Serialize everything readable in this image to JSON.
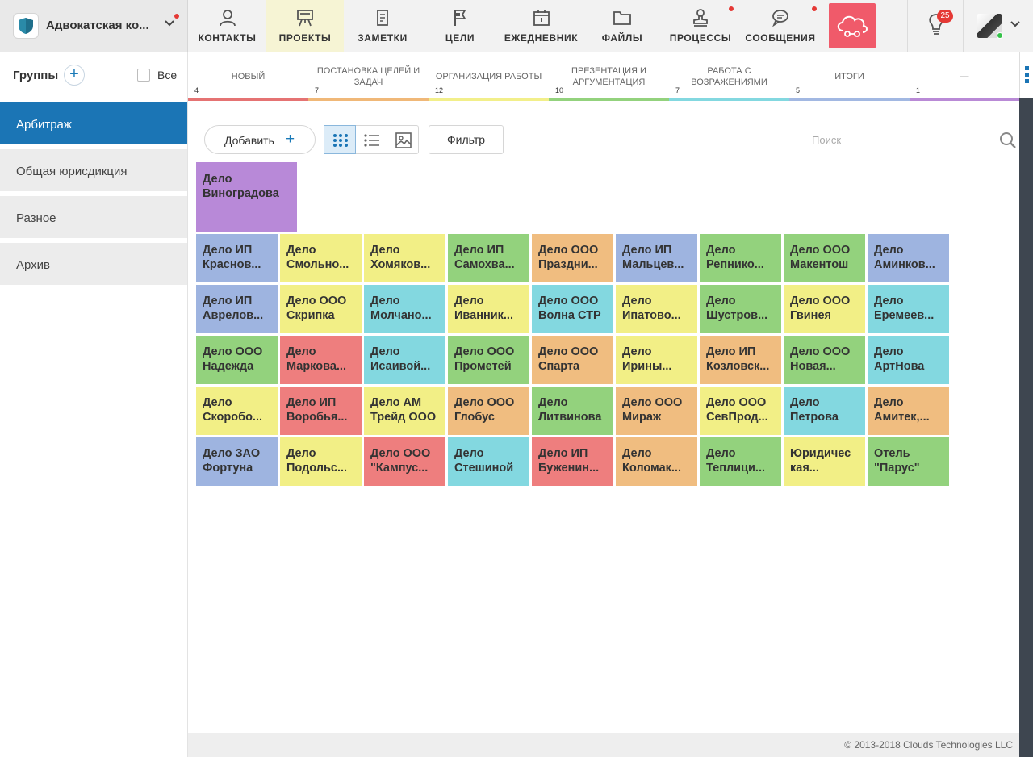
{
  "brand": {
    "name": "Адвокатская ко..."
  },
  "nav": [
    {
      "label": "КОНТАКТЫ",
      "icon": "user-icon"
    },
    {
      "label": "ПРОЕКТЫ",
      "icon": "easel-icon"
    },
    {
      "label": "ЗАМЕТКИ",
      "icon": "notes-icon"
    },
    {
      "label": "ЦЕЛИ",
      "icon": "flag-icon"
    },
    {
      "label": "ЕЖЕДНЕВНИК",
      "icon": "calendar-icon"
    },
    {
      "label": "ФАЙЛЫ",
      "icon": "folder-icon"
    },
    {
      "label": "ПРОЦЕССЫ",
      "icon": "stamp-icon"
    },
    {
      "label": "СООБЩЕНИЯ",
      "icon": "chat-icon"
    }
  ],
  "notifications": {
    "count": "25"
  },
  "sidebar": {
    "title": "Группы",
    "all_label": "Все",
    "groups": [
      "Арбитраж",
      "Общая юрисдикция",
      "Разное",
      "Архив"
    ]
  },
  "stages": [
    {
      "name": "НОВЫЙ",
      "count": "4",
      "color": "#e57373"
    },
    {
      "name": "ПОСТАНОВКА ЦЕЛЕЙ И ЗАДАЧ",
      "count": "7",
      "color": "#f0b878"
    },
    {
      "name": "ОРГАНИЗАЦИЯ РАБОТЫ",
      "count": "12",
      "color": "#f2ef8a"
    },
    {
      "name": "ПРЕЗЕНТАЦИЯ И АРГУМЕНТАЦИЯ",
      "count": "10",
      "color": "#93d27d"
    },
    {
      "name": "РАБОТА С ВОЗРАЖЕНИЯМИ",
      "count": "7",
      "color": "#83d8e0"
    },
    {
      "name": "ИТОГИ",
      "count": "5",
      "color": "#a2b8e2"
    },
    {
      "name": "—",
      "count": "1",
      "color": "#b98ad6"
    }
  ],
  "toolbar": {
    "add_label": "Добавить",
    "filter_label": "Фильтр",
    "search_placeholder": "Поиск"
  },
  "projects": {
    "top": {
      "line1": "Дело",
      "line2": "Виноградова",
      "color": "#b889d8"
    },
    "grid": [
      [
        {
          "line1": "Дело ИП",
          "line2": "Краснов...",
          "color": "#9eb4e0"
        },
        {
          "line1": "Дело",
          "line2": "Смольно...",
          "color": "#f2ef86"
        },
        {
          "line1": "Дело",
          "line2": "Хомяков...",
          "color": "#f2ef86"
        },
        {
          "line1": "Дело ИП",
          "line2": "Самохва...",
          "color": "#93d27d"
        },
        {
          "line1": "Дело ООО",
          "line2": "Праздни...",
          "color": "#f0bd80"
        },
        {
          "line1": "Дело ИП",
          "line2": "Мальцев...",
          "color": "#9eb4e0"
        },
        {
          "line1": "Дело",
          "line2": "Репнико...",
          "color": "#93d27d"
        },
        {
          "line1": "Дело ООО",
          "line2": "Макентош",
          "color": "#93d27d"
        },
        {
          "line1": "Дело",
          "line2": "Аминков...",
          "color": "#9eb4e0"
        }
      ],
      [
        {
          "line1": "Дело ИП",
          "line2": "Аврелов...",
          "color": "#9eb4e0"
        },
        {
          "line1": "Дело ООО",
          "line2": "Скрипка",
          "color": "#f2ef86"
        },
        {
          "line1": "Дело",
          "line2": "Молчано...",
          "color": "#83d8e0"
        },
        {
          "line1": "Дело",
          "line2": "Иванник...",
          "color": "#f2ef86"
        },
        {
          "line1": "Дело ООО",
          "line2": "Волна СТР",
          "color": "#83d8e0"
        },
        {
          "line1": "Дело",
          "line2": "Ипатово...",
          "color": "#f2ef86"
        },
        {
          "line1": "Дело",
          "line2": "Шустров...",
          "color": "#93d27d"
        },
        {
          "line1": "Дело ООО",
          "line2": "Гвинея",
          "color": "#f2ef86"
        },
        {
          "line1": "Дело",
          "line2": "Еремеев...",
          "color": "#83d8e0"
        }
      ],
      [
        {
          "line1": "Дело ООО",
          "line2": "Надежда",
          "color": "#93d27d"
        },
        {
          "line1": "Дело",
          "line2": "Маркова...",
          "color": "#ee7e7e"
        },
        {
          "line1": "Дело",
          "line2": "Исаивой...",
          "color": "#83d8e0"
        },
        {
          "line1": "Дело ООО",
          "line2": "Прометей",
          "color": "#93d27d"
        },
        {
          "line1": "Дело ООО",
          "line2": "Спарта",
          "color": "#f0bd80"
        },
        {
          "line1": "Дело",
          "line2": "Ирины...",
          "color": "#f2ef86"
        },
        {
          "line1": "Дело ИП",
          "line2": "Козловск...",
          "color": "#f0bd80"
        },
        {
          "line1": "Дело ООО",
          "line2": "Новая...",
          "color": "#93d27d"
        },
        {
          "line1": "Дело",
          "line2": "АртНова",
          "color": "#83d8e0"
        }
      ],
      [
        {
          "line1": "Дело",
          "line2": "Скоробо...",
          "color": "#f2ef86"
        },
        {
          "line1": "Дело ИП",
          "line2": "Воробья...",
          "color": "#ee7e7e"
        },
        {
          "line1": "Дело АМ",
          "line2": "Трейд ООО",
          "color": "#f2ef86"
        },
        {
          "line1": "Дело ООО",
          "line2": "Глобус",
          "color": "#f0bd80"
        },
        {
          "line1": "Дело",
          "line2": "Литвинова",
          "color": "#93d27d"
        },
        {
          "line1": "Дело ООО",
          "line2": "Мираж",
          "color": "#f0bd80"
        },
        {
          "line1": "Дело ООО",
          "line2": "СевПрод...",
          "color": "#f2ef86"
        },
        {
          "line1": "Дело",
          "line2": "Петрова",
          "color": "#83d8e0"
        },
        {
          "line1": "Дело",
          "line2": "Амитек,...",
          "color": "#f0bd80"
        }
      ],
      [
        {
          "line1": "Дело ЗАО",
          "line2": "Фортуна",
          "color": "#9eb4e0"
        },
        {
          "line1": "Дело",
          "line2": "Подольс...",
          "color": "#f2ef86"
        },
        {
          "line1": "Дело ООО",
          "line2": "\"Кампус...",
          "color": "#ee7e7e"
        },
        {
          "line1": "Дело",
          "line2": "Стешиной",
          "color": "#83d8e0"
        },
        {
          "line1": "Дело ИП",
          "line2": "Буженин...",
          "color": "#ee7e7e"
        },
        {
          "line1": "Дело",
          "line2": "Коломак...",
          "color": "#f0bd80"
        },
        {
          "line1": "Дело",
          "line2": "Теплици...",
          "color": "#93d27d"
        },
        {
          "line1": "Юридичес",
          "line2": "кая...",
          "color": "#f2ef86"
        },
        {
          "line1": "Отель",
          "line2": "\"Парус\"",
          "color": "#93d27d"
        }
      ]
    ]
  },
  "footer": {
    "copyright": "© 2013-2018 Clouds Technologies LLC"
  }
}
